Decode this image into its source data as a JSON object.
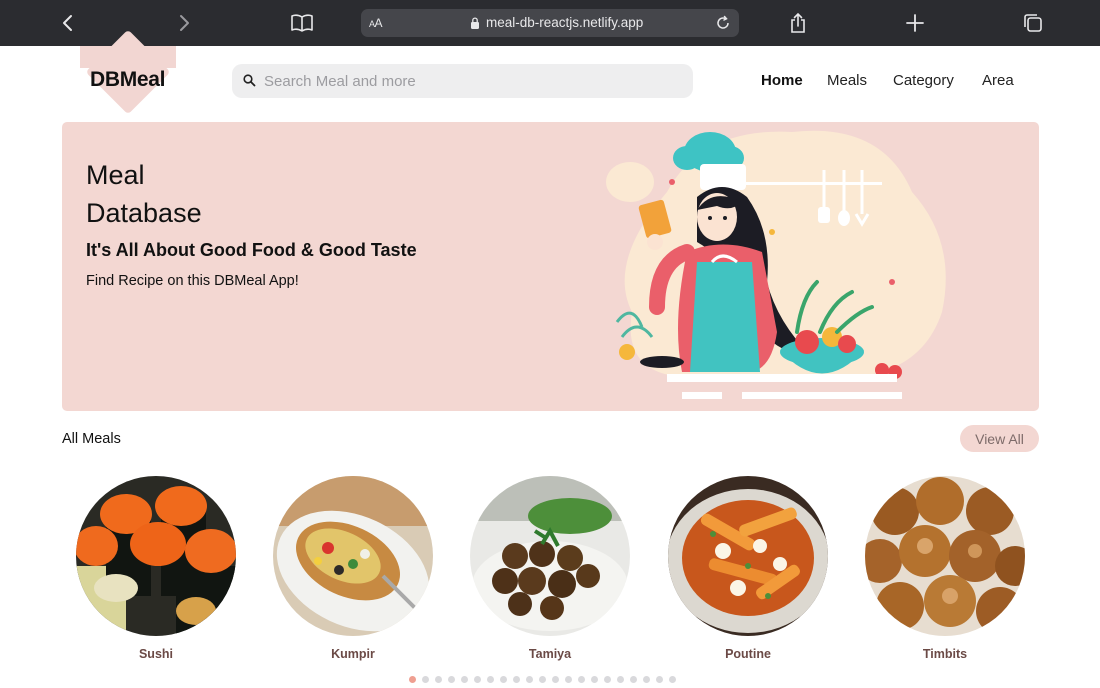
{
  "browser": {
    "aa_label": "AA",
    "url": "meal-db-reactjs.netlify.app"
  },
  "header": {
    "logo": "DBMeal",
    "search_placeholder": "Search Meal and more",
    "nav": [
      {
        "label": "Home",
        "active": true
      },
      {
        "label": "Meals",
        "active": false
      },
      {
        "label": "Category",
        "active": false
      },
      {
        "label": "Area",
        "active": false
      }
    ]
  },
  "hero": {
    "title_line1": "Meal",
    "title_line2": "Database",
    "subtitle": "It's All About Good Food & Good Taste",
    "tagline": "Find Recipe on this DBMeal App!"
  },
  "meals_section": {
    "title": "All Meals",
    "view_all": "View All",
    "meals": [
      {
        "name": "Sushi"
      },
      {
        "name": "Kumpir"
      },
      {
        "name": "Tamiya"
      },
      {
        "name": "Poutine"
      },
      {
        "name": "Timbits"
      }
    ],
    "pagination_count": 21,
    "pagination_active_index": 0
  },
  "colors": {
    "accent": "#f3d7d2",
    "dot_active": "#ef9f91",
    "meal_name": "#6b4a46"
  }
}
